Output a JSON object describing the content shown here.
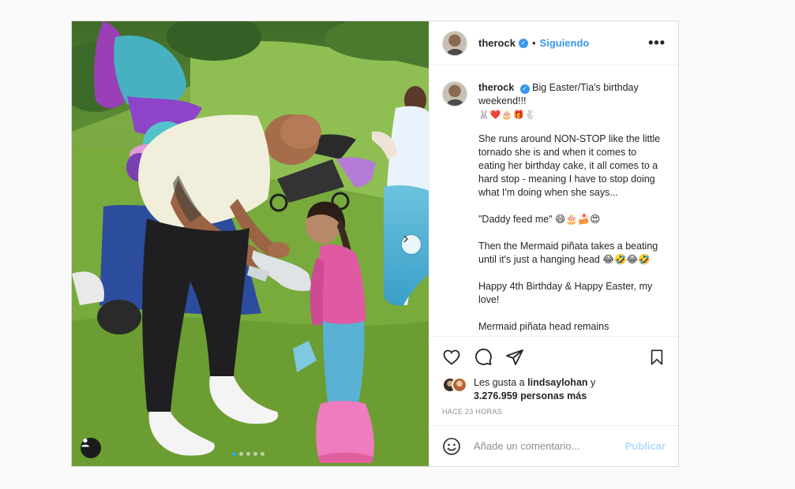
{
  "post": {
    "username": "therock",
    "separator": "•",
    "follow_label": "Siguiendo",
    "more_label": "•••",
    "caption": {
      "username": "therock",
      "first_line": "Big Easter/Tia's birthday weekend!!!",
      "emoji_line": "🐰❤️🎂🎁🐇",
      "paragraphs": [
        "She runs around NON-STOP like the little tornado she is and when it comes to eating her birthday cake, it all comes to a hard stop - meaning I have to stop doing what I'm doing when she says...",
        "\"Daddy feed me\" 😄🎂🍰😍",
        "Then the Mermaid piñata takes a beating until it's just a hanging head 😂🤣😂🤣",
        "Happy 4th Birthday & Happy Easter, my love!",
        "Mermaid piñata head remains"
      ]
    },
    "likes": {
      "prefix": "Les gusta a",
      "user": "lindsaylohan",
      "joiner": "y",
      "count": "3.276.959 personas más"
    },
    "time_ago": "HACE 23 HORAS",
    "comment": {
      "placeholder": "Añade un comentario...",
      "publish_label": "Publicar"
    },
    "carousel": {
      "slides": 5,
      "active_index": 0
    }
  },
  "colors": {
    "accent": "#3897f0",
    "publish_disabled": "#b3dbff",
    "carousel_active": "#2aa7f3",
    "border": "#dbdbdb"
  },
  "icons": {
    "header": [
      "verified-icon",
      "more-options-icon"
    ],
    "actions": [
      "heart-icon",
      "comment-icon",
      "share-icon",
      "bookmark-icon"
    ],
    "photo": [
      "next-arrow-icon",
      "user-tag-icon"
    ],
    "comment": [
      "emoji-icon"
    ]
  }
}
